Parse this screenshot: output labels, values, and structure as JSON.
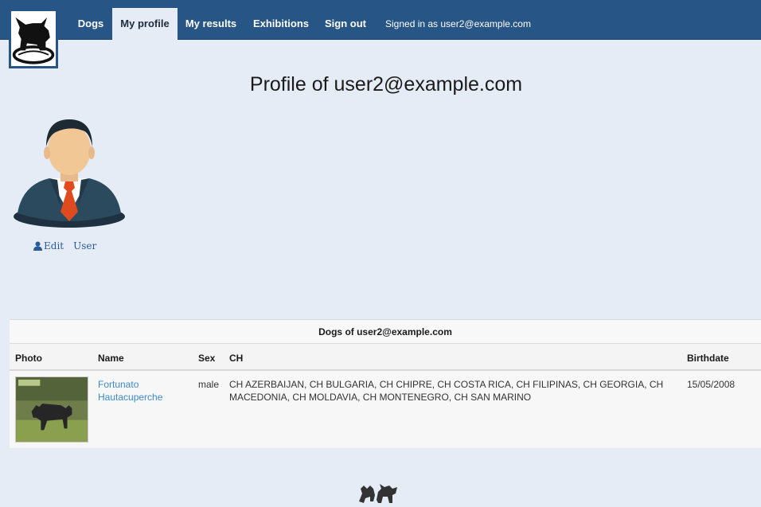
{
  "nav": {
    "items": [
      {
        "label": "Dogs",
        "active": false
      },
      {
        "label": "My profile",
        "active": true
      },
      {
        "label": "My results",
        "active": false
      },
      {
        "label": "Exhibitions",
        "active": false
      },
      {
        "label": "Sign out",
        "active": false
      }
    ],
    "signed_in_text": "Signed in as user2@example.com",
    "logo_icon": "bulldog-logo-icon"
  },
  "profile": {
    "title": "Profile of user2@example.com",
    "avatar_icon": "user-avatar-icon",
    "edit_label": "Edit",
    "user_label": "User"
  },
  "dogs": {
    "heading": "Dogs of user2@example.com",
    "columns": [
      "Photo",
      "Name",
      "Sex",
      "CH",
      "Birthdate"
    ],
    "rows": [
      {
        "name_line1": "Fortunato",
        "name_line2": "Hautacuperche",
        "sex": "male",
        "ch_line1": "CH AZERBAIJAN, CH BULGARIA, CH CHIPRE, CH COSTA RICA, CH FILIPINAS, CH GEORGIA, CH",
        "ch_line2": "MACEDONIA, CH MOLDAVIA, CH MONTENEGRO, CH SAN MARINO",
        "birthdate": "15/05/2008"
      }
    ]
  },
  "footer": {
    "icon": "two-bulldogs-icon"
  },
  "colors": {
    "navbar": "#275585",
    "background": "#e6ecf6",
    "link": "#3d8ac9"
  }
}
